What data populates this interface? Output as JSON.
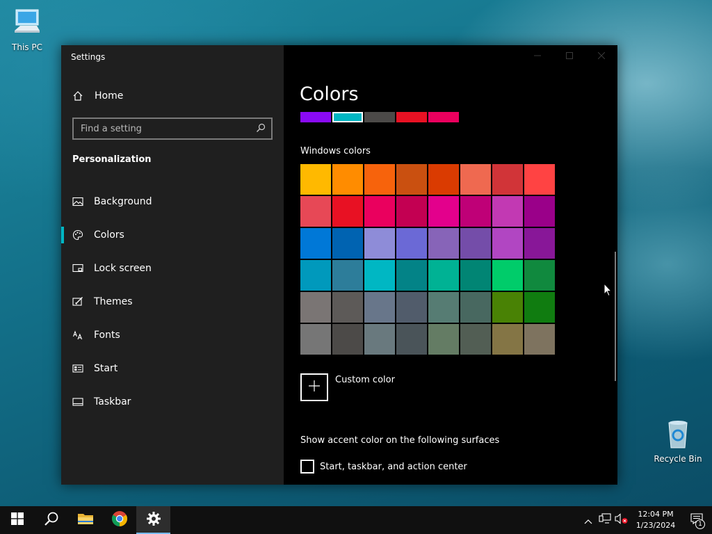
{
  "desktop": {
    "icons": [
      {
        "label": "This PC",
        "icon": "this-pc-icon"
      },
      {
        "label": "Recycle Bin",
        "icon": "recycle-bin-icon"
      }
    ]
  },
  "window": {
    "title": "Settings",
    "controls": {
      "minimize": "minimize-icon",
      "maximize": "maximize-icon",
      "close": "close-icon"
    }
  },
  "sidebar": {
    "home_label": "Home",
    "search_placeholder": "Find a setting",
    "section_title": "Personalization",
    "items": [
      {
        "label": "Background",
        "icon": "picture-icon"
      },
      {
        "label": "Colors",
        "icon": "palette-icon",
        "active": true
      },
      {
        "label": "Lock screen",
        "icon": "lock-screen-icon"
      },
      {
        "label": "Themes",
        "icon": "themes-icon"
      },
      {
        "label": "Fonts",
        "icon": "fonts-icon"
      },
      {
        "label": "Start",
        "icon": "start-icon"
      },
      {
        "label": "Taskbar",
        "icon": "taskbar-icon"
      }
    ]
  },
  "main": {
    "page_title": "Colors",
    "recent_colors": [
      "#8a0af5",
      "#00b7c3",
      "#4c4a48",
      "#e81123",
      "#ea005e"
    ],
    "recent_selected_index": 1,
    "windows_colors_label": "Windows colors",
    "windows_colors": [
      "#ffb900",
      "#ff8c00",
      "#f7630c",
      "#ca5010",
      "#da3b01",
      "#ef6950",
      "#d13438",
      "#ff4343",
      "#e74856",
      "#e81123",
      "#ea005e",
      "#c30052",
      "#e3008c",
      "#bf0077",
      "#c239b3",
      "#9a0089",
      "#0078d7",
      "#0063b1",
      "#8e8cd8",
      "#6b69d6",
      "#8764b8",
      "#744da9",
      "#b146c2",
      "#881798",
      "#0099bc",
      "#2d7d9a",
      "#00b7c3",
      "#038387",
      "#00b294",
      "#018574",
      "#00cc6a",
      "#10893e",
      "#7a7574",
      "#5d5a58",
      "#68768a",
      "#515c6b",
      "#567c73",
      "#486860",
      "#498205",
      "#107c10",
      "#767676",
      "#4c4a48",
      "#69797e",
      "#4a5459",
      "#647c64",
      "#525e54",
      "#847545",
      "#7e735f"
    ],
    "custom_color_label": "Custom color",
    "surfaces_label": "Show accent color on the following surfaces",
    "checkbox_label": "Start, taskbar, and action center",
    "checkbox_checked": false
  },
  "taskbar": {
    "apps": [
      {
        "name": "start",
        "icon": "windows-logo-icon"
      },
      {
        "name": "search",
        "icon": "search-icon"
      },
      {
        "name": "file-explorer",
        "icon": "folder-icon"
      },
      {
        "name": "chrome",
        "icon": "chrome-icon"
      },
      {
        "name": "settings",
        "icon": "gear-icon",
        "active": true
      }
    ],
    "tray": {
      "time": "12:04 PM",
      "date": "1/23/2024",
      "notification_count": "1"
    }
  }
}
